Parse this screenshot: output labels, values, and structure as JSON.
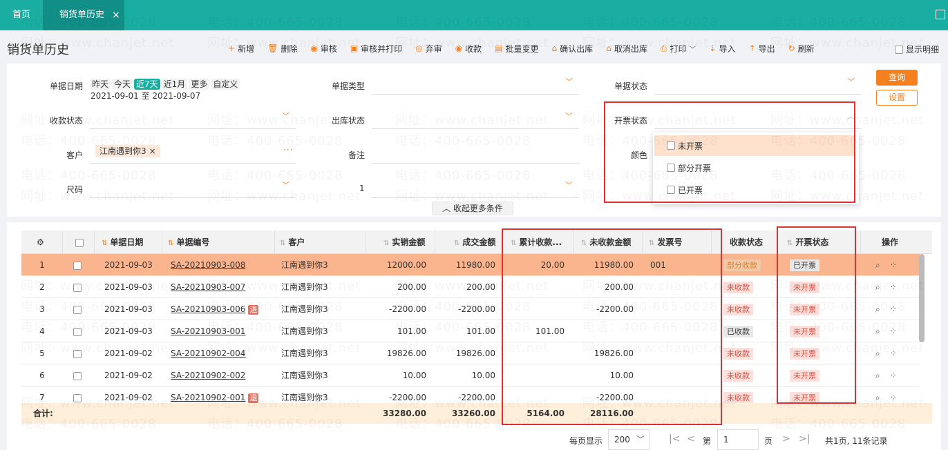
{
  "tabs": {
    "home": "首页",
    "active": "销货单历史",
    "close": "×"
  },
  "page_title": "销货单历史",
  "toolbar": [
    {
      "label": "新增",
      "icon": "+"
    },
    {
      "label": "删除",
      "icon": "🗑"
    },
    {
      "label": "审核",
      "icon": "◉"
    },
    {
      "label": "审核并打印",
      "icon": "▣"
    },
    {
      "label": "弃审",
      "icon": "◎"
    },
    {
      "label": "收款",
      "icon": "◉"
    },
    {
      "label": "批量变更",
      "icon": "▤"
    },
    {
      "label": "确认出库",
      "icon": "⌂"
    },
    {
      "label": "取消出库",
      "icon": "⌂"
    },
    {
      "label": "打印",
      "icon": "⎙"
    },
    {
      "label": "导入",
      "icon": "⇣"
    },
    {
      "label": "导出",
      "icon": "⇡"
    },
    {
      "label": "刷新",
      "icon": "↻"
    }
  ],
  "show_detail": "显示明细",
  "filter": {
    "doc_date_label": "单据日期",
    "quick": [
      "昨天",
      "今天",
      "近7天",
      "近1月",
      "更多",
      "自定义"
    ],
    "quick_active": "近7天",
    "date_from": "2021-09-01",
    "date_sep": "至",
    "date_to": "2021-09-07",
    "doc_type_label": "单据类型",
    "doc_status_label": "单据状态",
    "pay_status_label": "收款状态",
    "out_status_label": "出库状态",
    "invoice_status_label": "开票状态",
    "customer_label": "客户",
    "customer_tag": "江南遇到你3",
    "remark_label": "备注",
    "color_label": "颜色",
    "size_label": "尺码",
    "size_value": "1",
    "collapse": "收起更多条件",
    "query": "查询",
    "settings": "设置"
  },
  "invoice_dropdown": [
    "未开票",
    "部分开票",
    "已开票"
  ],
  "table": {
    "headers": [
      "单据日期",
      "单据编号",
      "客户",
      "实销金额",
      "成交金额",
      "累计收款...",
      "未收款金额",
      "发票号",
      "收款状态",
      "开票状态",
      "操作"
    ],
    "rows": [
      {
        "no": "1",
        "date": "2021-09-03",
        "code": "SA-20210903-008",
        "ret": "",
        "customer": "江南遇到你3",
        "actual": "12000.00",
        "deal": "11980.00",
        "received": "20.00",
        "unreceived": "11980.00",
        "invoice_no": "001",
        "pay_status": "部分收款",
        "inv_status": "已开票"
      },
      {
        "no": "2",
        "date": "2021-09-03",
        "code": "SA-20210903-007",
        "ret": "",
        "customer": "江南遇到你3",
        "actual": "200.00",
        "deal": "200.00",
        "received": "",
        "unreceived": "200.00",
        "invoice_no": "",
        "pay_status": "未收款",
        "inv_status": "未开票"
      },
      {
        "no": "3",
        "date": "2021-09-03",
        "code": "SA-20210903-006",
        "ret": "退",
        "customer": "江南遇到你3",
        "actual": "-2200.00",
        "deal": "-2200.00",
        "received": "",
        "unreceived": "-2200.00",
        "invoice_no": "",
        "pay_status": "未收款",
        "inv_status": "未开票"
      },
      {
        "no": "4",
        "date": "2021-09-03",
        "code": "SA-20210903-001",
        "ret": "",
        "customer": "江南遇到你3",
        "actual": "101.00",
        "deal": "101.00",
        "received": "101.00",
        "unreceived": "",
        "invoice_no": "",
        "pay_status": "已收款",
        "inv_status": "未开票"
      },
      {
        "no": "5",
        "date": "2021-09-02",
        "code": "SA-20210902-004",
        "ret": "",
        "customer": "江南遇到你3",
        "actual": "19826.00",
        "deal": "19826.00",
        "received": "",
        "unreceived": "19826.00",
        "invoice_no": "",
        "pay_status": "未收款",
        "inv_status": "未开票"
      },
      {
        "no": "6",
        "date": "2021-09-02",
        "code": "SA-20210902-002",
        "ret": "",
        "customer": "江南遇到你3",
        "actual": "10.00",
        "deal": "10.00",
        "received": "",
        "unreceived": "10.00",
        "invoice_no": "",
        "pay_status": "未收款",
        "inv_status": "未开票"
      },
      {
        "no": "7",
        "date": "2021-09-02",
        "code": "SA-20210902-001",
        "ret": "退",
        "customer": "江南遇到你3",
        "actual": "-2200.00",
        "deal": "-2200.00",
        "received": "",
        "unreceived": "-2200.00",
        "invoice_no": "",
        "pay_status": "未收款",
        "inv_status": "未开票"
      }
    ],
    "total": {
      "label": "合计:",
      "actual": "33280.00",
      "deal": "33260.00",
      "received": "5164.00",
      "unreceived": "28116.00"
    }
  },
  "pager": {
    "per_page_label": "每页显示",
    "per_page": "200",
    "page_prefix": "第",
    "page": "1",
    "page_suffix": "页",
    "summary": "共1页, 11条记录"
  },
  "watermark": {
    "phone": "电话：400-665-0028",
    "site": "网址：www.chanjet.net"
  },
  "colors": {
    "accent": "#1aaea3",
    "orange": "#f5801f",
    "highlight": "#e03030"
  }
}
